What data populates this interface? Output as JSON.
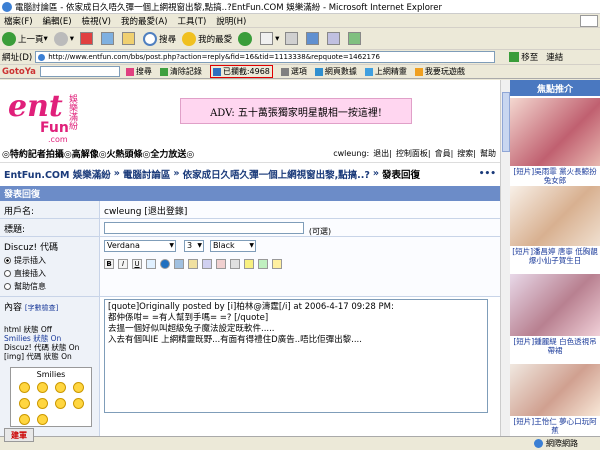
{
  "window": {
    "title": "電腦討論區 - 依家成日久唔久彈一個上網視窗出黎,點搞..?EntFun.COM 娛樂滿紛 - Microsoft Internet Explorer"
  },
  "menu": [
    "檔案(F)",
    "編輯(E)",
    "檢視(V)",
    "我的最愛(A)",
    "工具(T)",
    "說明(H)"
  ],
  "toolbar": {
    "back": "上一頁",
    "search": "搜尋",
    "favorites": "我的最愛"
  },
  "address": {
    "label": "網址(D)",
    "url": "http://www.entfun.com/bbs/post.php?action=reply&fid=16&tid=1113338&repquote=1462176",
    "go": "移至",
    "links": "連結"
  },
  "gotoya": {
    "logo": "GotoYa",
    "search": "搜尋",
    "clear": "清除記錄",
    "blocked": "已攔截:4968",
    "options": "選項",
    "webdata": "網頁數據",
    "refresh": "上網精靈",
    "play": "我要玩遊戲"
  },
  "banner": {
    "adv": "ADV: 五十萬張獨家明星靚相一按這裡!",
    "logo_text": "ent",
    "logo_sub": "Fun",
    "logo_dotcom": ".com",
    "logo_cn": "娛樂滿紛"
  },
  "newsline": {
    "text": "◎特約記者拍攝◎高解像◎火熱頭條◎全力放送◎",
    "user": "cwleung:",
    "links": [
      "退出",
      "控制面板",
      "會員",
      "搜索",
      "幫助"
    ]
  },
  "breadcrumb": {
    "items": [
      "EntFun.COM 娛樂滿紛",
      "電腦討論區",
      "依家成日久唔久彈一個上網視窗出黎,點搞..?",
      "發表回復"
    ],
    "sep": "»",
    "more": "•••"
  },
  "section": {
    "title": "發表回復"
  },
  "form": {
    "username_label": "用戶名:",
    "username_value": "cwleung [退出登錄]",
    "title_label": "標題:",
    "title_hint": "(可選)",
    "discuz_label": "Discuz! 代碼",
    "radio_options": [
      "提示插入",
      "直接插入",
      "幫助信息"
    ],
    "font_select": "Verdana",
    "size_select": "3",
    "color_select": "Black",
    "content_label": "內容",
    "content_hint": "[字數檢查]",
    "status_lines": [
      "html 狀態 Off",
      "Smilies 狀態 On",
      "Discuz! 代碼 狀態 On",
      "[img] 代碼 狀態 On"
    ],
    "smilies_title": "Smilies",
    "textarea_text": "[quote]Originally posted by [i]柏林@濤霆[/i] at 2006-4-17 09:28 PM:\n都仲係咁= =有人幫到手嗎= =? [/quote]\n去搵一個好似叫超級兔子魔法設定既軟件.....\n入去有個叫IE 上網精靈既野...有面有得禮住D廣告..唔比佢彈出黎....",
    "editor_buttons": [
      "B",
      "I",
      "U"
    ]
  },
  "sidebar": {
    "title": "焦點推介",
    "items": [
      {
        "caption": "[短片]吳雨霏 黨火長鯨扮兔女郎"
      },
      {
        "caption": "[短片]潘昌婷 唐寧 低胸靚爆小仙子賀生日"
      },
      {
        "caption": "[短片]鍾麗緹 白色透視吊帶裙"
      },
      {
        "caption": "[短片]王怡仁 夢心口玩阿蕉"
      }
    ]
  },
  "statusbar": {
    "zone": "網際網路"
  },
  "tray": {
    "label": "建軍"
  }
}
